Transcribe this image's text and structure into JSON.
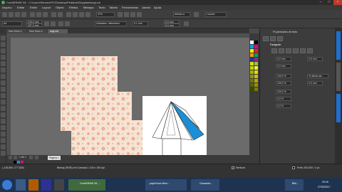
{
  "window": {
    "title": "CorelDRAW X8 - C:\\Users\\Simone\\PC\\Desktop\\Pedidos\\Gloyplast\\svgl.cdr"
  },
  "menu": [
    "Arquivo",
    "Editar",
    "Exibir",
    "Layout",
    "Objeto",
    "Efeitos",
    "Bitmaps",
    "Texto",
    "Tabela",
    "Ferramentas",
    "Janela",
    "Ajuda"
  ],
  "toolbar1": {
    "zoom": "37%",
    "snap": "Alinhar a",
    "launch": "Launch"
  },
  "toolbar2": {
    "page_size": "A4",
    "width": "210,0 mm",
    "height": "297,0 mm",
    "units_label": "Unidades: milímetros",
    "nudge": "0,1 mm",
    "dup_x": "5,0 mm",
    "dup_y": "5,0 mm"
  },
  "tabs": [
    "Sem título-1",
    "Sem título-2",
    "svgl.cdr"
  ],
  "active_tab": "svgl.cdr",
  "docker": {
    "title": "Propriedades de texto",
    "section": "Parágrafo",
    "value1": "0,0 mm",
    "value2": "0,0 mm",
    "value3": "0,0 mm",
    "value4": "100,0 %",
    "value5": "% altura car...",
    "value6": "100,0 %",
    "value7": "0,0 mm",
    "value8": "100,0 %",
    "value9": "0,0 %",
    "value10": "0,0 %"
  },
  "pagenav": {
    "counter": "1 de 1",
    "page_label": "Página 1"
  },
  "status": {
    "coords": "(-128,584; 277,828)",
    "info": "Bitmap (RGB) em Camada 1 106 x 106 dpi",
    "fill": "Nenhum",
    "outline": "Preto  200,000 / 2 px"
  },
  "taskbar": {
    "items": [
      "CorelDRAW X8 - ...",
      "papel lizan flexo...",
      "Gravando...",
      "Bits..."
    ],
    "time": "20:18",
    "date": "27/03/2017"
  },
  "colors": {
    "accent": "#1e6fd0",
    "canvas": "#6b6b6b",
    "cyan_shape": "#1a8fd6"
  }
}
